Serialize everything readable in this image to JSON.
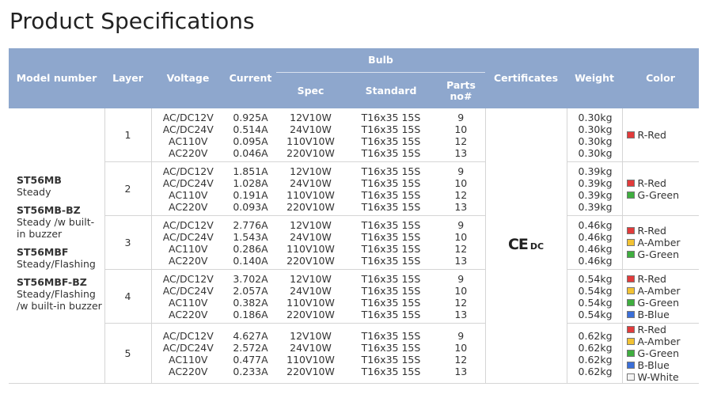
{
  "title": "Product Specifications",
  "headers": {
    "model": "Model number",
    "layer": "Layer",
    "voltage": "Voltage",
    "current": "Current",
    "bulb": "Bulb",
    "spec": "Spec",
    "standard": "Standard",
    "parts": "Parts no#",
    "certificates": "Certificates",
    "weight": "Weight",
    "color": "Color"
  },
  "models": [
    {
      "name": "ST56MB",
      "desc": "Steady"
    },
    {
      "name": "ST56MB-BZ",
      "desc": "Steady /w built-in buzzer"
    },
    {
      "name": "ST56MBF",
      "desc": "Steady/Flashing"
    },
    {
      "name": "ST56MBF-BZ",
      "desc": "Steady/Flashing /w built-in buzzer"
    }
  ],
  "certificate": {
    "mark": "CE",
    "sub": "DC"
  },
  "rows": [
    {
      "layer": "1",
      "voltage": [
        "AC/DC12V",
        "AC/DC24V",
        "AC110V",
        "AC220V"
      ],
      "current": [
        "0.925A",
        "0.514A",
        "0.095A",
        "0.046A"
      ],
      "spec": [
        "12V10W",
        "24V10W",
        "110V10W",
        "220V10W"
      ],
      "standard": [
        "T16x35 15S",
        "T16x35 15S",
        "T16x35 15S",
        "T16x35 15S"
      ],
      "parts": [
        "9",
        "10",
        "12",
        "13"
      ],
      "weight": [
        "0.30kg",
        "0.30kg",
        "0.30kg",
        "0.30kg"
      ],
      "colors": [
        {
          "label": "R-Red",
          "hex": "#e23b3b"
        }
      ]
    },
    {
      "layer": "2",
      "voltage": [
        "AC/DC12V",
        "AC/DC24V",
        "AC110V",
        "AC220V"
      ],
      "current": [
        "1.851A",
        "1.028A",
        "0.191A",
        "0.093A"
      ],
      "spec": [
        "12V10W",
        "24V10W",
        "110V10W",
        "220V10W"
      ],
      "standard": [
        "T16x35 15S",
        "T16x35 15S",
        "T16x35 15S",
        "T16x35 15S"
      ],
      "parts": [
        "9",
        "10",
        "12",
        "13"
      ],
      "weight": [
        "0.39kg",
        "0.39kg",
        "0.39kg",
        "0.39kg"
      ],
      "colors": [
        {
          "label": "R-Red",
          "hex": "#e23b3b"
        },
        {
          "label": "G-Green",
          "hex": "#3fae3f"
        }
      ]
    },
    {
      "layer": "3",
      "voltage": [
        "AC/DC12V",
        "AC/DC24V",
        "AC110V",
        "AC220V"
      ],
      "current": [
        "2.776A",
        "1.543A",
        "0.286A",
        "0.140A"
      ],
      "spec": [
        "12V10W",
        "24V10W",
        "110V10W",
        "220V10W"
      ],
      "standard": [
        "T16x35 15S",
        "T16x35 15S",
        "T16x35 15S",
        "T16x35 15S"
      ],
      "parts": [
        "9",
        "10",
        "12",
        "13"
      ],
      "weight": [
        "0.46kg",
        "0.46kg",
        "0.46kg",
        "0.46kg"
      ],
      "colors": [
        {
          "label": "R-Red",
          "hex": "#e23b3b"
        },
        {
          "label": "A-Amber",
          "hex": "#f2c233"
        },
        {
          "label": "G-Green",
          "hex": "#3fae3f"
        }
      ]
    },
    {
      "layer": "4",
      "voltage": [
        "AC/DC12V",
        "AC/DC24V",
        "AC110V",
        "AC220V"
      ],
      "current": [
        "3.702A",
        "2.057A",
        "0.382A",
        "0.186A"
      ],
      "spec": [
        "12V10W",
        "24V10W",
        "110V10W",
        "220V10W"
      ],
      "standard": [
        "T16x35 15S",
        "T16x35 15S",
        "T16x35 15S",
        "T16x35 15S"
      ],
      "parts": [
        "9",
        "10",
        "12",
        "13"
      ],
      "weight": [
        "0.54kg",
        "0.54kg",
        "0.54kg",
        "0.54kg"
      ],
      "colors": [
        {
          "label": "R-Red",
          "hex": "#e23b3b"
        },
        {
          "label": "A-Amber",
          "hex": "#f2c233"
        },
        {
          "label": "G-Green",
          "hex": "#3fae3f"
        },
        {
          "label": "B-Blue",
          "hex": "#3b6fd8"
        }
      ]
    },
    {
      "layer": "5",
      "voltage": [
        "AC/DC12V",
        "AC/DC24V",
        "AC110V",
        "AC220V"
      ],
      "current": [
        "4.627A",
        "2.572A",
        "0.477A",
        "0.233A"
      ],
      "spec": [
        "12V10W",
        "24V10W",
        "110V10W",
        "220V10W"
      ],
      "standard": [
        "T16x35 15S",
        "T16x35 15S",
        "T16x35 15S",
        "T16x35 15S"
      ],
      "parts": [
        "9",
        "10",
        "12",
        "13"
      ],
      "weight": [
        "0.62kg",
        "0.62kg",
        "0.62kg",
        "0.62kg"
      ],
      "colors": [
        {
          "label": "R-Red",
          "hex": "#e23b3b"
        },
        {
          "label": "A-Amber",
          "hex": "#f2c233"
        },
        {
          "label": "G-Green",
          "hex": "#3fae3f"
        },
        {
          "label": "B-Blue",
          "hex": "#3b6fd8"
        },
        {
          "label": "W-White",
          "hex": "#f4f4f4"
        }
      ]
    }
  ]
}
